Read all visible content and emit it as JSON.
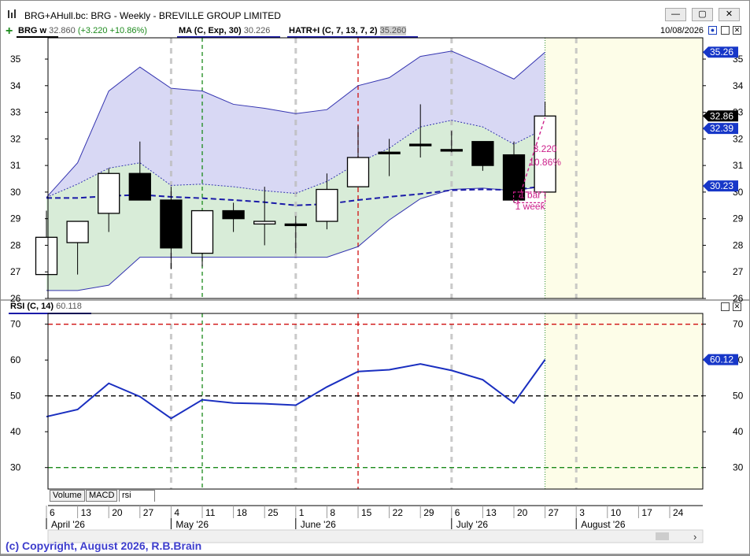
{
  "window": {
    "title": "BRG+AHull.bc: BRG - Weekly - BREVILLE GROUP LIMITED",
    "minimize_glyph": "—",
    "maximize_glyph": "▢",
    "close_glyph": "✕"
  },
  "legend": {
    "symbol": "BRG w",
    "price": "32.860",
    "change": "(+3.220 +10.86%)",
    "ma_label": "MA (C, Exp, 30)",
    "ma_value": "30.226",
    "hatr_label": "HATR+I (C, 7, 13, 7, 2)",
    "hatr_value": "35.260",
    "date": "10/08/2026"
  },
  "rsi_legend": {
    "label": "RSI (C, 14)",
    "value": "60.118"
  },
  "tabs": [
    "Volume",
    "MACD",
    "rsi"
  ],
  "copyright": "(c) Copyright, August 2026, R.B.Brain",
  "colors": {
    "upper_band_fill": "#d8d8f4",
    "lower_band_fill": "#d8ecd8",
    "ma_line": "#1a1aa8",
    "band_line": "#3434b0",
    "rsi_line": "#1a2fc0",
    "future_zone": "#fdfde8",
    "annotation": "#cc1f8a",
    "rsi_badge": "#1737c8"
  },
  "chart_data": [
    {
      "type": "candlestick",
      "title": "BRG weekly price",
      "x_ticks": [
        "6",
        "13",
        "20",
        "27",
        "4",
        "11",
        "18",
        "25",
        "1",
        "8",
        "15",
        "22",
        "29",
        "6",
        "13",
        "20",
        "27",
        "3",
        "10",
        "17",
        "24"
      ],
      "month_labels": [
        {
          "label": "April '26",
          "week": "6"
        },
        {
          "label": "May '26",
          "week": "4"
        },
        {
          "label": "June '26",
          "week": "1"
        },
        {
          "label": "July '26",
          "week": "6"
        },
        {
          "label": "August '26",
          "week": "3"
        }
      ],
      "ylim": [
        26,
        35.8
      ],
      "y_ticks": [
        26,
        27,
        28,
        29,
        30,
        31,
        32,
        33,
        34,
        35
      ],
      "candles": [
        {
          "open": 26.9,
          "high": 29.3,
          "low": 26.9,
          "close": 28.3
        },
        {
          "open": 28.1,
          "high": 28.9,
          "low": 26.9,
          "close": 28.9
        },
        {
          "open": 29.2,
          "high": 30.9,
          "low": 28.5,
          "close": 30.7
        },
        {
          "open": 30.7,
          "high": 31.9,
          "low": 29.7,
          "close": 29.7
        },
        {
          "open": 29.7,
          "high": 30.2,
          "low": 27.1,
          "close": 27.9
        },
        {
          "open": 27.7,
          "high": 29.3,
          "low": 27.2,
          "close": 29.3
        },
        {
          "open": 29.3,
          "high": 29.6,
          "low": 28.5,
          "close": 29.0
        },
        {
          "open": 28.8,
          "high": 30.2,
          "low": 28.0,
          "close": 28.9
        },
        {
          "open": 28.8,
          "high": 29.1,
          "low": 27.7,
          "close": 28.8
        },
        {
          "open": 28.9,
          "high": 30.7,
          "low": 28.6,
          "close": 30.1
        },
        {
          "open": 30.2,
          "high": 32.5,
          "low": 30.2,
          "close": 31.3
        },
        {
          "open": 31.5,
          "high": 32.0,
          "low": 30.6,
          "close": 31.5
        },
        {
          "open": 31.8,
          "high": 33.3,
          "low": 31.3,
          "close": 31.8
        },
        {
          "open": 31.6,
          "high": 32.3,
          "low": 31.5,
          "close": 31.6
        },
        {
          "open": 31.9,
          "high": 31.9,
          "low": 30.8,
          "close": 31.0
        },
        {
          "open": 31.4,
          "high": 31.9,
          "low": 29.6,
          "close": 29.7
        },
        {
          "open": 30.0,
          "high": 33.4,
          "low": 29.8,
          "close": 32.86
        }
      ],
      "ma": [
        29.78,
        29.78,
        29.85,
        29.9,
        29.82,
        29.77,
        29.7,
        29.62,
        29.5,
        29.55,
        29.7,
        29.82,
        29.93,
        30.07,
        30.1,
        30.08,
        30.23
      ],
      "hatr_upper": [
        29.8,
        31.1,
        33.8,
        34.7,
        33.9,
        33.8,
        33.3,
        33.15,
        32.95,
        33.1,
        34.0,
        34.3,
        35.1,
        35.3,
        34.8,
        34.25,
        35.26
      ],
      "hatr_mid": [
        29.8,
        30.3,
        30.9,
        31.1,
        30.25,
        30.3,
        30.2,
        30.05,
        29.95,
        30.4,
        31.1,
        31.65,
        32.45,
        32.7,
        32.45,
        31.8,
        32.39
      ],
      "hatr_lower": [
        26.3,
        26.3,
        26.5,
        27.55,
        27.55,
        27.55,
        27.55,
        27.55,
        27.55,
        27.55,
        27.95,
        28.95,
        29.75,
        30.1,
        30.15,
        30.05,
        30.23
      ],
      "right_labels": [
        "35.26",
        "32.86",
        "32.39",
        "30.23"
      ],
      "annotation": {
        "change": "3.220",
        "percent": "10.86%",
        "bars": "1 bar",
        "period": "1 week"
      }
    },
    {
      "type": "line",
      "title": "RSI (C, 14)",
      "ylim": [
        24,
        73
      ],
      "y_ticks": [
        30,
        40,
        50,
        60,
        70
      ],
      "reference_lines": [
        70,
        50,
        30
      ],
      "values": [
        44.2,
        46.2,
        53.5,
        49.8,
        43.7,
        48.9,
        48.0,
        47.8,
        47.4,
        52.5,
        56.8,
        57.3,
        58.9,
        57.1,
        54.5,
        48.0,
        60.12
      ],
      "last_label": "60.12"
    }
  ]
}
